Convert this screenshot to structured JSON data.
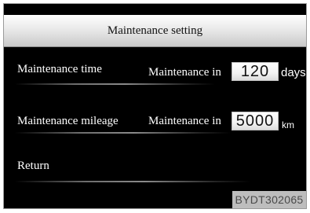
{
  "screen": {
    "title": "Maintenance setting"
  },
  "rows": [
    {
      "label": "Maintenance time",
      "prefix": "Maintenance in",
      "value": "120",
      "unit": "days"
    },
    {
      "label": "Maintenance mileage",
      "prefix": "Maintenance in",
      "value": "5000",
      "unit": "km"
    },
    {
      "label": "Return"
    }
  ],
  "figure_code": "BYDT302065"
}
